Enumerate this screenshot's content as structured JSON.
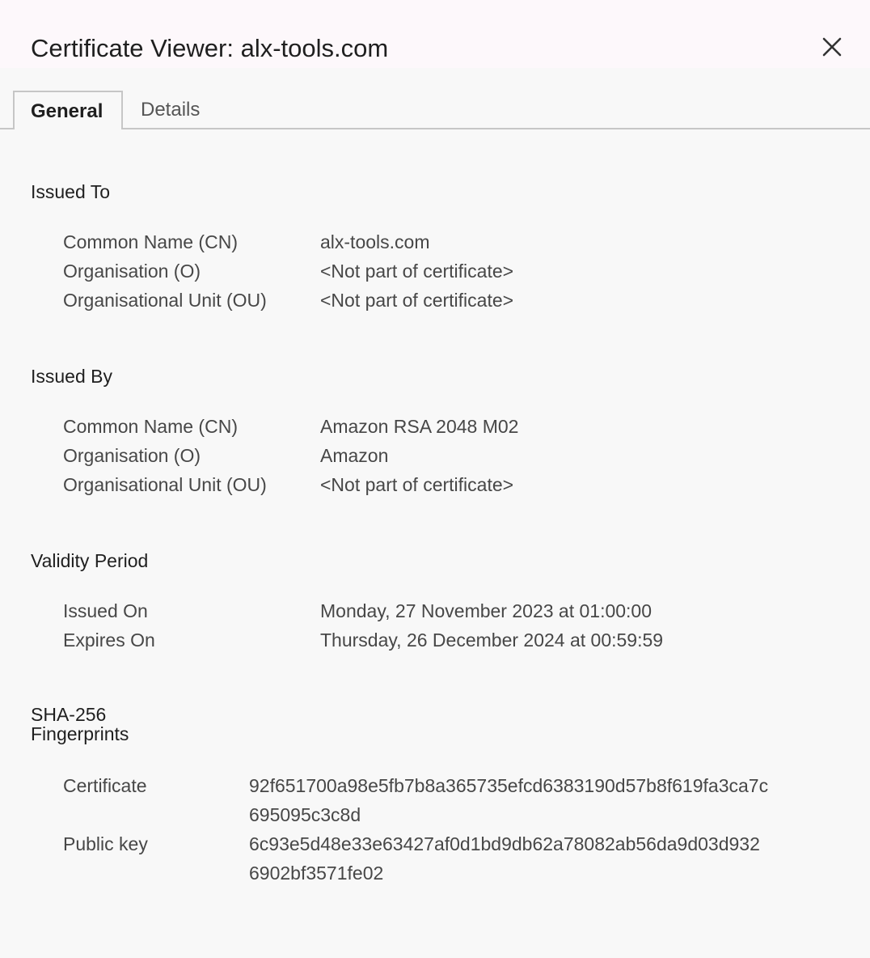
{
  "dialog": {
    "title": "Certificate Viewer: alx-tools.com"
  },
  "tabs": [
    {
      "label": "General",
      "selected": true
    },
    {
      "label": "Details",
      "selected": false
    }
  ],
  "issued_to": {
    "heading": "Issued To",
    "rows": [
      {
        "label": "Common Name (CN)",
        "value": "alx-tools.com"
      },
      {
        "label": "Organisation (O)",
        "value": "<Not part of certificate>"
      },
      {
        "label": "Organisational Unit (OU)",
        "value": "<Not part of certificate>"
      }
    ]
  },
  "issued_by": {
    "heading": "Issued By",
    "rows": [
      {
        "label": "Common Name (CN)",
        "value": "Amazon RSA 2048 M02"
      },
      {
        "label": "Organisation (O)",
        "value": "Amazon"
      },
      {
        "label": "Organisational Unit (OU)",
        "value": "<Not part of certificate>"
      }
    ]
  },
  "validity": {
    "heading": "Validity Period",
    "rows": [
      {
        "label": "Issued On",
        "value": "Monday, 27 November 2023 at 01:00:00"
      },
      {
        "label": "Expires On",
        "value": "Thursday, 26 December 2024 at 00:59:59"
      }
    ]
  },
  "fingerprints": {
    "heading_line1": "SHA-256",
    "heading_line2": "Fingerprints",
    "rows": [
      {
        "label": "Certificate",
        "value_line1": "92f651700a98e5fb7b8a365735efcd6383190d57b8f619fa3ca7c",
        "value_line2": "695095c3c8d"
      },
      {
        "label": "Public key",
        "value_line1": "6c93e5d48e33e63427af0d1bd9db62a78082ab56da9d03d932",
        "value_line2": "6902bf3571fe02"
      }
    ]
  }
}
